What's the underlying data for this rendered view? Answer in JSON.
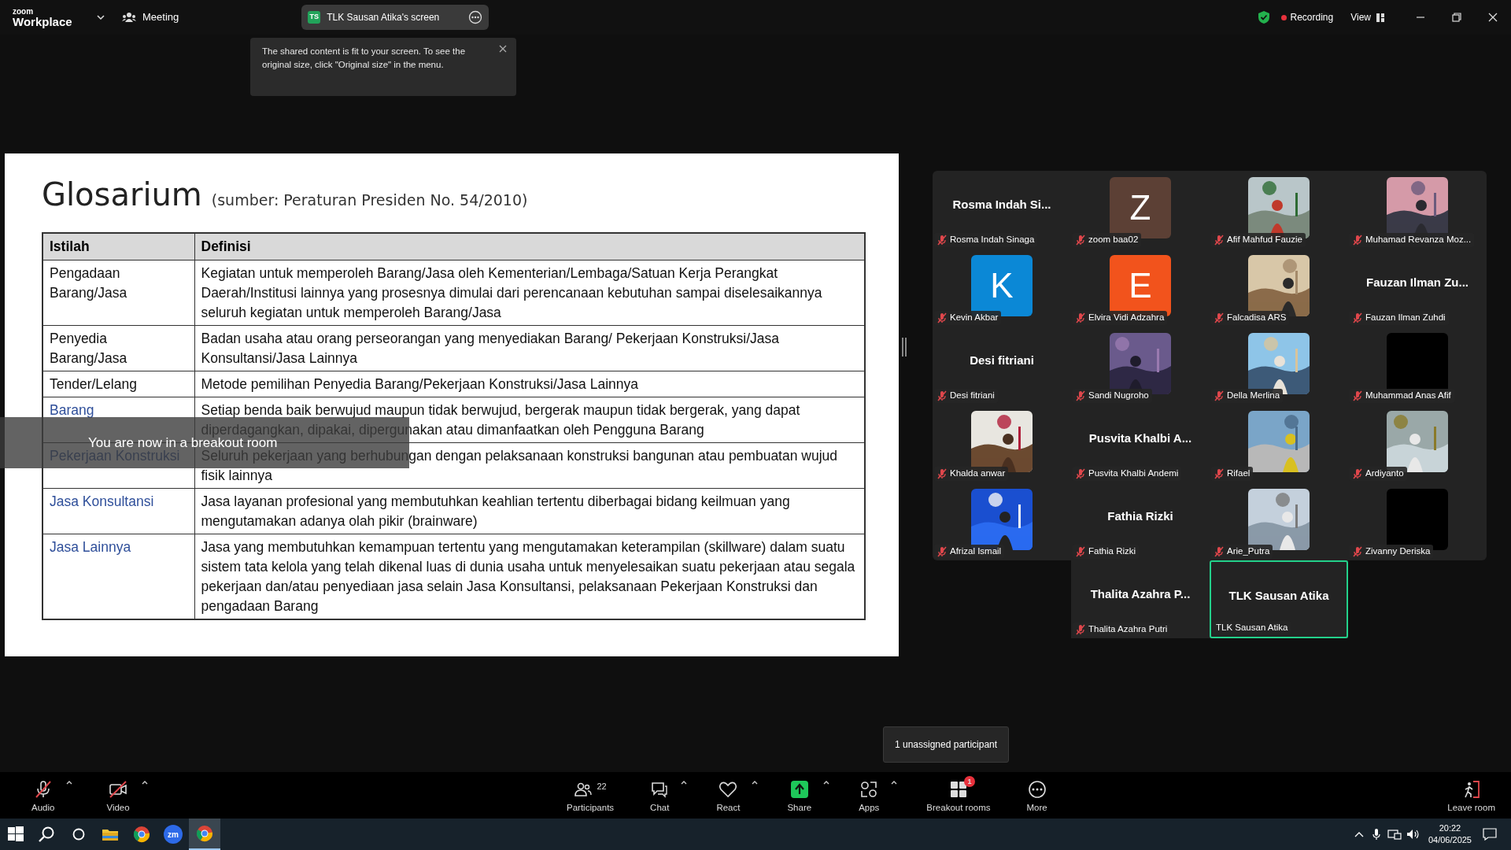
{
  "top_bar": {
    "brand_small": "zoom",
    "brand": "Workplace",
    "meeting_label": "Meeting",
    "share_pill": {
      "initials": "TS",
      "label": "TLK Sausan Atika's screen"
    },
    "recording": "Recording",
    "view": "View"
  },
  "share_notice": "The shared content is fit to your screen. To see the original size, click \"Original size\" in the menu.",
  "slide": {
    "title": "Glosarium",
    "subtitle": "(sumber: Peraturan Presiden No. 54/2010)",
    "columns": [
      "Istilah",
      "Definisi"
    ],
    "rows": [
      {
        "term": "Pengadaan Barang/Jasa",
        "linked": false,
        "definition": "Kegiatan untuk memperoleh Barang/Jasa oleh Kementerian/Lembaga/Satuan Kerja Perangkat Daerah/Institusi lainnya yang prosesnya dimulai dari perencanaan kebutuhan sampai diselesaikannya seluruh kegiatan untuk memperoleh Barang/Jasa"
      },
      {
        "term": "Penyedia Barang/Jasa",
        "linked": false,
        "definition": "Badan usaha atau orang perseorangan yang menyediakan Barang/ Pekerjaan Konstruksi/Jasa Konsultansi/Jasa Lainnya"
      },
      {
        "term": "Tender/Lelang",
        "linked": false,
        "definition": "Metode pemilihan Penyedia Barang/Pekerjaan Konstruksi/Jasa Lainnya"
      },
      {
        "term": "Barang",
        "linked": true,
        "definition": "Setiap benda baik berwujud maupun tidak berwujud, bergerak maupun tidak bergerak, yang dapat diperdagangkan, dipakai, dipergunakan atau dimanfaatkan oleh Pengguna Barang"
      },
      {
        "term": "Pekerjaan Konstruksi",
        "linked": true,
        "definition": "Seluruh pekerjaan yang berhubungan dengan pelaksanaan konstruksi bangunan atau pembuatan wujud fisik lainnya"
      },
      {
        "term": "Jasa Konsultansi",
        "linked": true,
        "definition": "Jasa layanan profesional yang membutuhkan keahlian tertentu diberbagai bidang keilmuan yang mengutamakan adanya olah pikir (brainware)"
      },
      {
        "term": "Jasa Lainnya",
        "linked": true,
        "definition": "Jasa yang membutuhkan kemampuan tertentu yang mengutamakan keterampilan (skillware) dalam suatu sistem tata kelola yang telah dikenal luas di dunia usaha untuk menyelesaikan suatu pekerjaan atau segala pekerjaan dan/atau penyediaan jasa selain Jasa Konsultansi, pelaksanaan Pekerjaan Konstruksi dan pengadaan Barang"
      }
    ]
  },
  "breakout_banner": "You are now in a breakout room",
  "gallery": [
    {
      "name": "Rosma Indah Sinaga",
      "tile": {
        "kind": "name",
        "text": "Rosma Indah Si..."
      },
      "muted": true,
      "selected": false
    },
    {
      "name": "zoom baa02",
      "tile": {
        "kind": "avatar",
        "letter": "Z",
        "color": "#5c4035"
      },
      "muted": true,
      "selected": false
    },
    {
      "name": "Afif Mahfud Fauzie",
      "muted": true,
      "selected": false
    },
    {
      "name": "Muhamad Revanza Moz...",
      "muted": true,
      "selected": false
    },
    {
      "name": "Kevin Akbar",
      "tile": {
        "kind": "avatar",
        "letter": "K",
        "color": "#0b88d6"
      },
      "muted": true,
      "selected": false
    },
    {
      "name": "Elvira Vidi Adzahra",
      "tile": {
        "kind": "avatar",
        "letter": "E",
        "color": "#f2531c"
      },
      "muted": true,
      "selected": false
    },
    {
      "name": "Falcadisa ARS",
      "muted": true,
      "selected": false
    },
    {
      "name": "Fauzan Ilman Zuhdi",
      "tile": {
        "kind": "name",
        "text": "Fauzan Ilman Zu..."
      },
      "muted": true,
      "selected": false
    },
    {
      "name": "Desi fitriani",
      "tile": {
        "kind": "name",
        "text": "Desi fitriani"
      },
      "muted": true,
      "selected": false
    },
    {
      "name": "Sandi Nugroho",
      "muted": true,
      "selected": false
    },
    {
      "name": "Della Merlina",
      "muted": true,
      "selected": false
    },
    {
      "name": "Muhammad Anas Afif",
      "tile": {
        "kind": "blank"
      },
      "muted": true,
      "selected": false
    },
    {
      "name": "Khalda anwar",
      "muted": true,
      "selected": false
    },
    {
      "name": "Pusvita Khalbi Andemi",
      "tile": {
        "kind": "name",
        "text": "Pusvita Khalbi A..."
      },
      "muted": true,
      "selected": false
    },
    {
      "name": "Rifael",
      "muted": true,
      "selected": false
    },
    {
      "name": "Ardiyanto",
      "muted": true,
      "selected": false
    },
    {
      "name": "Afrizal Ismail",
      "muted": true,
      "selected": false
    },
    {
      "name": "Fathia Rizki",
      "tile": {
        "kind": "name",
        "text": "Fathia Rizki"
      },
      "muted": true,
      "selected": false
    },
    {
      "name": "Arie_Putra",
      "muted": true,
      "selected": false
    },
    {
      "name": "Zivanny Deriska",
      "tile": {
        "kind": "blank"
      },
      "muted": true,
      "selected": false
    }
  ],
  "gallery_overflow": [
    {
      "name": "Thalita Azahra Putri",
      "tile": {
        "kind": "name",
        "text": "Thalita Azahra P..."
      },
      "muted": true,
      "selected": false
    },
    {
      "name": "TLK Sausan Atika",
      "tile": {
        "kind": "name",
        "text": "TLK Sausan Atika"
      },
      "muted": false,
      "selected": true
    }
  ],
  "tooltip": "1 unassigned participant",
  "toolbar": {
    "left": [
      {
        "kind": "audio",
        "label": "Audio",
        "caret": true
      },
      {
        "kind": "video",
        "label": "Video",
        "caret": true
      }
    ],
    "center": [
      {
        "kind": "participants",
        "label": "Participants",
        "count": "22",
        "caret": false
      },
      {
        "kind": "chat",
        "label": "Chat",
        "caret": true
      },
      {
        "kind": "react",
        "label": "React",
        "caret": true
      },
      {
        "kind": "share",
        "label": "Share",
        "caret": true
      },
      {
        "kind": "apps",
        "label": "Apps",
        "caret": true
      },
      {
        "kind": "breakout",
        "label": "Breakout rooms",
        "badge": "1",
        "caret": false
      },
      {
        "kind": "more",
        "label": "More",
        "caret": false
      }
    ],
    "right": [
      {
        "kind": "leave",
        "label": "Leave room",
        "caret": false
      }
    ]
  },
  "taskbar": {
    "apps": [
      {
        "kind": "start",
        "selected": false
      },
      {
        "kind": "search",
        "selected": false
      },
      {
        "kind": "taskview",
        "selected": false
      },
      {
        "kind": "files",
        "selected": false
      },
      {
        "kind": "chrome",
        "selected": false
      },
      {
        "kind": "zoom",
        "label": "zm",
        "selected": false
      },
      {
        "kind": "chrome",
        "selected": true
      }
    ],
    "time": "20:22",
    "date": "04/06/2025"
  }
}
